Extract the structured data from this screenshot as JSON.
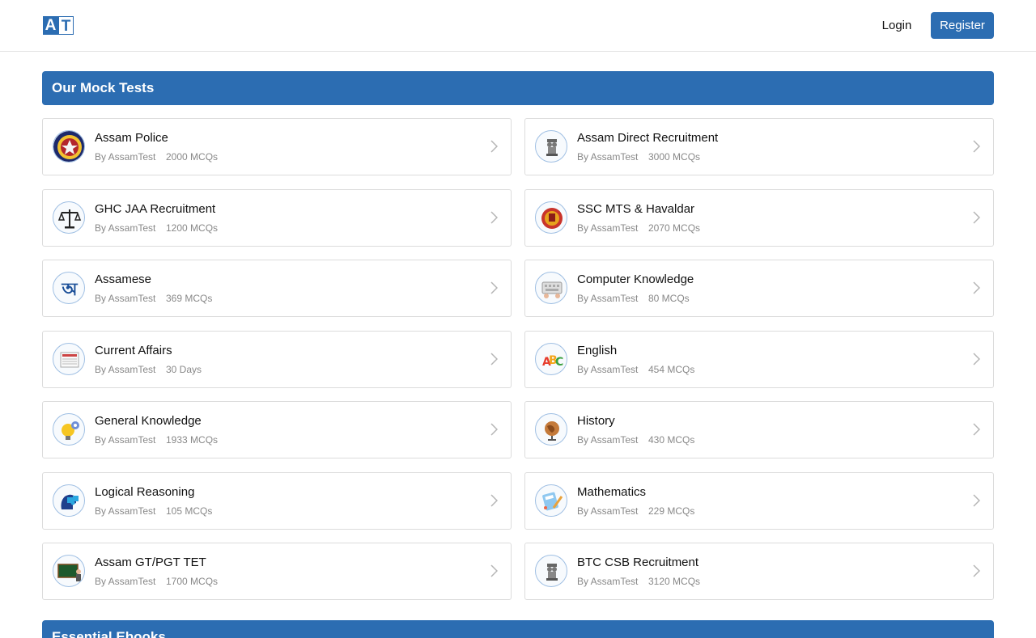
{
  "header": {
    "logo_letters": [
      "A",
      "T"
    ],
    "login_label": "Login",
    "register_label": "Register",
    "brand_color": "#2c6db2"
  },
  "mock_tests": {
    "heading": "Our Mock Tests",
    "items": [
      {
        "title": "Assam Police",
        "author": "By AssamTest",
        "meta": "2000 MCQs",
        "icon": "police-badge-icon"
      },
      {
        "title": "Assam Direct Recruitment",
        "author": "By AssamTest",
        "meta": "3000 MCQs",
        "icon": "emblem-icon"
      },
      {
        "title": "GHC JAA Recruitment",
        "author": "By AssamTest",
        "meta": "1200 MCQs",
        "icon": "scales-of-justice-icon"
      },
      {
        "title": "SSC MTS & Havaldar",
        "author": "By AssamTest",
        "meta": "2070 MCQs",
        "icon": "ssc-seal-icon"
      },
      {
        "title": "Assamese",
        "author": "By AssamTest",
        "meta": "369 MCQs",
        "icon": "assamese-letter-icon"
      },
      {
        "title": "Computer Knowledge",
        "author": "By AssamTest",
        "meta": "80 MCQs",
        "icon": "keyboard-icon"
      },
      {
        "title": "Current Affairs",
        "author": "By AssamTest",
        "meta": "30 Days",
        "icon": "newspaper-icon"
      },
      {
        "title": "English",
        "author": "By AssamTest",
        "meta": "454 MCQs",
        "icon": "abc-icon"
      },
      {
        "title": "General Knowledge",
        "author": "By AssamTest",
        "meta": "1933 MCQs",
        "icon": "lightbulb-gear-icon"
      },
      {
        "title": "History",
        "author": "By AssamTest",
        "meta": "430 MCQs",
        "icon": "globe-icon"
      },
      {
        "title": "Logical Reasoning",
        "author": "By AssamTest",
        "meta": "105 MCQs",
        "icon": "puzzle-head-icon"
      },
      {
        "title": "Mathematics",
        "author": "By AssamTest",
        "meta": "229 MCQs",
        "icon": "math-tools-icon"
      },
      {
        "title": "Assam GT/PGT TET",
        "author": "By AssamTest",
        "meta": "1700 MCQs",
        "icon": "blackboard-teacher-icon"
      },
      {
        "title": "BTC CSB Recruitment",
        "author": "By AssamTest",
        "meta": "3120 MCQs",
        "icon": "emblem-icon"
      }
    ]
  },
  "ebooks": {
    "heading": "Essential Ebooks"
  }
}
